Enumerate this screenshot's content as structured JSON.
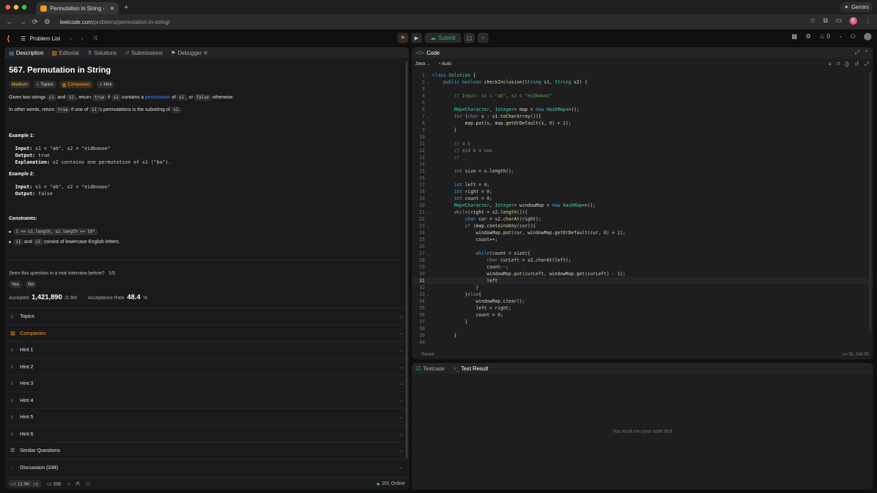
{
  "browser": {
    "tab_title": "Permutation in String - LeetC",
    "url_host": "leetcode.com",
    "url_path": "/problems/permutation-in-string/",
    "gemini_label": "Gemini",
    "profile_initial": "E",
    "dot_colors": [
      "#ff5f57",
      "#febc2e",
      "#28c840"
    ]
  },
  "header": {
    "problem_list_label": "Problem List",
    "submit_label": "Submit",
    "notifications_count": "0"
  },
  "left_tabs": [
    "Description",
    "Editorial",
    "Solutions",
    "Submissions",
    "Debugger"
  ],
  "problem": {
    "title": "567. Permutation in String",
    "tags": [
      "Medium",
      "Topics",
      "Companies",
      "Hint"
    ],
    "p1": {
      "a": "Given two strings ",
      "s1": "s1",
      "b": " and ",
      "s2": "s2",
      "c": ", return ",
      "true": "true",
      "d": " if ",
      "s2b": "s2",
      "e": " contains a ",
      "link": "permutation",
      "f": " of ",
      "s1b": "s1",
      "g": ", or ",
      "false": "false",
      "h": " otherwise."
    },
    "p2": {
      "a": "In other words, return ",
      "true": "true",
      "b": " if one of ",
      "s1": "s1",
      "c": "'s permutations is the substring of ",
      "s2": "s2",
      "d": "."
    },
    "example1_title": "Example 1:",
    "example1": {
      "input_label": "Input:",
      "input": " s1 = \"ab\", s2 = \"eidbaooo\"",
      "output_label": "Output:",
      "output": " true",
      "expl_label": "Explanation:",
      "expl": " s2 contains one permutation of s1 (\"ba\")."
    },
    "example2_title": "Example 2:",
    "example2": {
      "input_label": "Input:",
      "input": " s1 = \"ab\", s2 = \"eidboaoo\"",
      "output_label": "Output:",
      "output": " false"
    },
    "constraints_title": "Constraints:",
    "constraint1": "1 <= s1.length, s2.length <= 10⁴",
    "constraint2": {
      "s1": "s1",
      "a": " and ",
      "s2": "s2",
      "b": " consist of lowercase English letters."
    },
    "seen_question": "Seen this question in a real interview before?",
    "seen_count": "1/5",
    "yes": "Yes",
    "no": "No",
    "accepted_label": "Accepted",
    "accepted_value": "1,421,890",
    "accepted_total": "/2.9M",
    "acceptance_label": "Acceptance Rate",
    "acceptance_value": "48.4",
    "acceptance_unit": "%"
  },
  "accordion": [
    "Topics",
    "Companies",
    "Hint 1",
    "Hint 2",
    "Hint 3",
    "Hint 4",
    "Hint 5",
    "Hint 6",
    "Similar Questions",
    "Discussion (338)"
  ],
  "footer": {
    "likes": "12.9K",
    "comments": "338",
    "online": "201 Online"
  },
  "code_panel": {
    "title": "Code",
    "language": "Java",
    "mode": "Auto",
    "status": "Saved",
    "cursor": "Ln 31, Col 25",
    "lines": [
      "class Solution {",
      "    public boolean checkInclusion(String s1, String s2) {",
      "",
      "        // Input: s1 = \"ab\", s2 = \"eidbaooo\"",
      "",
      "        Map<Character, Integer> map = new HashMap<>();",
      "        for (char s : s1.toCharArray()){",
      "            map.put(s, map.getOrDefault(s, 0) + 1);",
      "        }",
      "",
      "        // a b",
      "        // eid b a ooo",
      "        // __",
      "",
      "        int size = s.length();",
      "",
      "        int left = 0;",
      "        int right = 0;",
      "        int count = 0;",
      "        Map<Character, Integer> windowMap = new HashMap<>();",
      "        while(right < s2.length()){",
      "            char cur = s2.charAt(right);",
      "            if (map.containsKey(cur)){",
      "                windowMap.put(cur, windowMap.getOrDefault(cur, 0) + 1);",
      "                count++;",
      "",
      "                while(count < size){",
      "                    char curLeft = s2.charAt(left);",
      "                    count--;",
      "                    windowMap.put(curLeft, windowMap.get(curLeft) - 1);",
      "                    left",
      "                }",
      "            }else{",
      "                windowMap.clear();",
      "                left = right;",
      "                count = 0;",
      "            }",
      "",
      "        }",
      ""
    ],
    "line_numbers": [
      "1",
      "2",
      "3",
      "4",
      "5",
      "6",
      "7",
      "8",
      "9",
      "10",
      "11",
      "12",
      "13",
      "14",
      "15",
      "16",
      "17",
      "18",
      "19",
      "20",
      "21",
      "22",
      "23",
      "24",
      "25",
      "26",
      "27",
      "28",
      "29",
      "30",
      "31",
      "32",
      "33",
      "34",
      "35",
      "36",
      "37",
      "38",
      "39",
      "40"
    ]
  },
  "test_panel": {
    "tabs": [
      "Testcase",
      "Test Result"
    ],
    "empty_message": "You must run your code first"
  }
}
